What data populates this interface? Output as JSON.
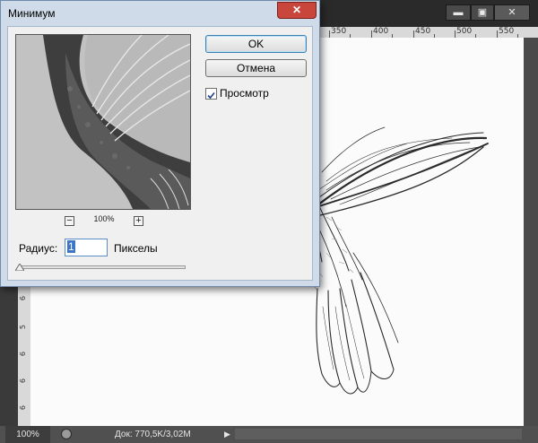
{
  "dialog": {
    "title": "Минимум",
    "close_label": "✕",
    "ok_label": "OK",
    "cancel_label": "Отмена",
    "preview_checkbox": {
      "label": "Просмотр",
      "checked": true
    },
    "zoom": {
      "value": "100%",
      "minus": "−",
      "plus": "+"
    },
    "radius": {
      "label": "Радиус:",
      "value": "1",
      "unit": "Пикселы"
    },
    "slider_fraction": 0.0
  },
  "app": {
    "window_buttons": {
      "minimize": "▬",
      "maximize": "▣",
      "close": "✕"
    },
    "ruler_top": [
      "350",
      "400",
      "450",
      "500",
      "550"
    ],
    "ruler_left": [
      "6",
      "5",
      "6",
      "6",
      "6"
    ],
    "status": {
      "zoom": "100%",
      "doc": "Док: 770,5K/3,02M",
      "arrow": "▶"
    }
  },
  "colors": {
    "dialog_frame": "#cfdbe9",
    "close_red": "#c9463d",
    "selection_blue": "#3b74c9"
  },
  "icons": [
    "close-icon",
    "minimize-icon",
    "maximize-icon",
    "zoom-out-icon",
    "zoom-in-icon",
    "checkmark-icon",
    "slider-thumb-icon",
    "status-info-icon"
  ]
}
